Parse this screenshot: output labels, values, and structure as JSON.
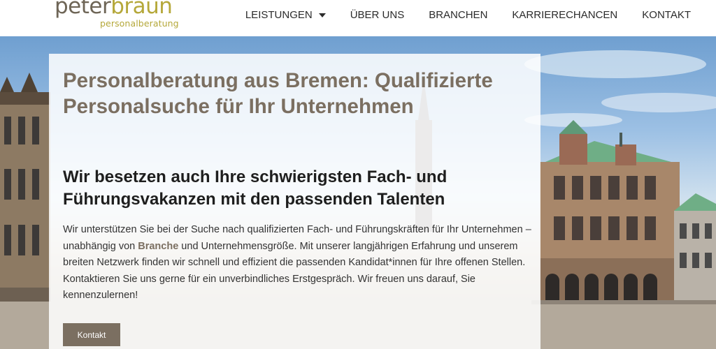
{
  "brand": {
    "name_part1": "peter",
    "name_part2": "braun",
    "tagline": "personalberatung"
  },
  "nav": {
    "items": [
      {
        "label": "LEISTUNGEN",
        "has_dropdown": true
      },
      {
        "label": "ÜBER UNS"
      },
      {
        "label": "BRANCHEN"
      },
      {
        "label": "KARRIERECHANCEN"
      },
      {
        "label": "KONTAKT"
      }
    ],
    "dropdown_icon": "caret-down-icon"
  },
  "hero": {
    "title": "Personalberatung aus Bremen: Qualifizierte Personalsuche für Ihr Unternehmen",
    "subtitle": "Wir besetzen auch Ihre schwierigsten Fach- und Führungsvakanzen mit den passenden Talenten",
    "body_part1": "Wir unterstützen Sie bei der Suche nach qualifizierten Fach- und Führungskräften für Ihr Unternehmen – unabhängig von ",
    "body_link": "Branche",
    "body_part2": " und Unternehmensgröße. Mit unserer langjährigen Erfahrung und unserem breiten Netzwerk finden wir schnell und effizient die passenden Kandidat*innen für Ihre offenen Stellen. Kontaktieren Sie uns gerne für ein unverbindliches Erstgespräch. Wir freuen uns darauf, Sie kennenzulernen!",
    "cta_label": "Kontakt"
  },
  "colors": {
    "brand_taupe": "#7b6f61",
    "brand_olive": "#b5a83a",
    "roof_green": "#6fae86"
  }
}
